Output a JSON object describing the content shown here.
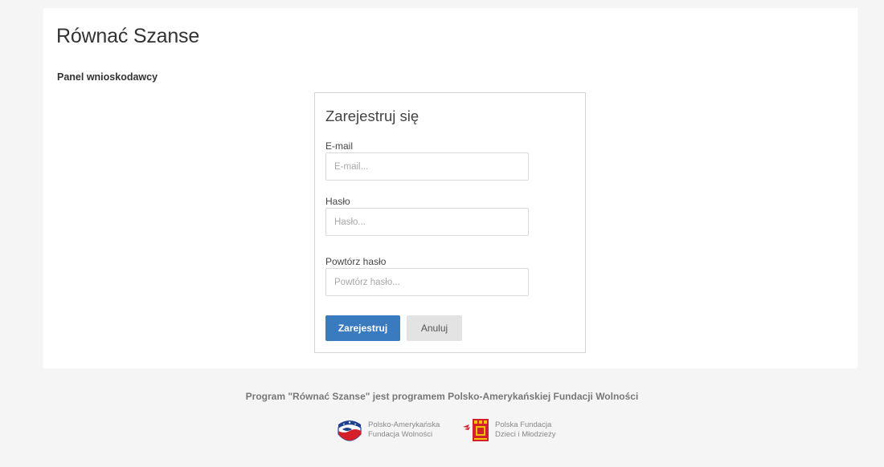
{
  "header": {
    "title": "Równać Szanse",
    "panel_label": "Panel wnioskodawcy"
  },
  "register_form": {
    "title": "Zarejestruj się",
    "email": {
      "label": "E-mail",
      "placeholder": "E-mail...",
      "value": ""
    },
    "password": {
      "label": "Hasło",
      "placeholder": "Hasło...",
      "value": ""
    },
    "password_repeat": {
      "label": "Powtórz hasło",
      "placeholder": "Powtórz hasło...",
      "value": ""
    },
    "submit_label": "Zarejestruj",
    "cancel_label": "Anuluj"
  },
  "footer": {
    "text": "Program \"Równać Szanse\" jest programem Polsko-Amerykańskiej Fundacji Wolności",
    "logos": [
      {
        "name": "pafw-logo",
        "line1": "Polsko-Amerykańska",
        "line2": "Fundacja Wolności"
      },
      {
        "name": "pfdim-logo",
        "line1": "Polska Fundacja",
        "line2": "Dzieci i Młodzieży"
      }
    ]
  },
  "colors": {
    "primary_button": "#3a7bc0",
    "secondary_button": "#e3e3e3",
    "page_background": "#f5f5f5"
  }
}
